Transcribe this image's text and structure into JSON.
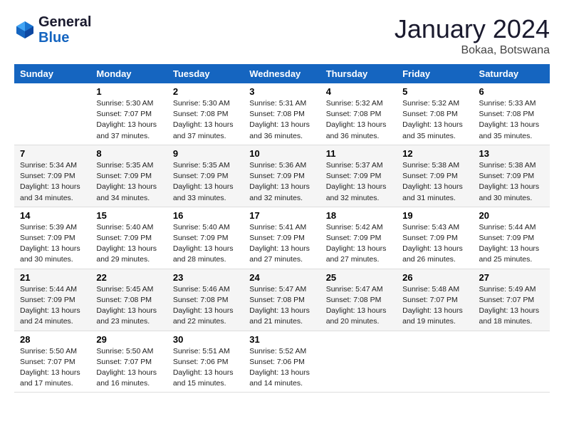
{
  "header": {
    "logo_general": "General",
    "logo_blue": "Blue",
    "month_year": "January 2024",
    "location": "Bokaa, Botswana"
  },
  "weekdays": [
    "Sunday",
    "Monday",
    "Tuesday",
    "Wednesday",
    "Thursday",
    "Friday",
    "Saturday"
  ],
  "weeks": [
    [
      {
        "day": "",
        "sunrise": "",
        "sunset": "",
        "daylight": ""
      },
      {
        "day": "1",
        "sunrise": "Sunrise: 5:30 AM",
        "sunset": "Sunset: 7:07 PM",
        "daylight": "Daylight: 13 hours and 37 minutes."
      },
      {
        "day": "2",
        "sunrise": "Sunrise: 5:30 AM",
        "sunset": "Sunset: 7:08 PM",
        "daylight": "Daylight: 13 hours and 37 minutes."
      },
      {
        "day": "3",
        "sunrise": "Sunrise: 5:31 AM",
        "sunset": "Sunset: 7:08 PM",
        "daylight": "Daylight: 13 hours and 36 minutes."
      },
      {
        "day": "4",
        "sunrise": "Sunrise: 5:32 AM",
        "sunset": "Sunset: 7:08 PM",
        "daylight": "Daylight: 13 hours and 36 minutes."
      },
      {
        "day": "5",
        "sunrise": "Sunrise: 5:32 AM",
        "sunset": "Sunset: 7:08 PM",
        "daylight": "Daylight: 13 hours and 35 minutes."
      },
      {
        "day": "6",
        "sunrise": "Sunrise: 5:33 AM",
        "sunset": "Sunset: 7:08 PM",
        "daylight": "Daylight: 13 hours and 35 minutes."
      }
    ],
    [
      {
        "day": "7",
        "sunrise": "Sunrise: 5:34 AM",
        "sunset": "Sunset: 7:09 PM",
        "daylight": "Daylight: 13 hours and 34 minutes."
      },
      {
        "day": "8",
        "sunrise": "Sunrise: 5:35 AM",
        "sunset": "Sunset: 7:09 PM",
        "daylight": "Daylight: 13 hours and 34 minutes."
      },
      {
        "day": "9",
        "sunrise": "Sunrise: 5:35 AM",
        "sunset": "Sunset: 7:09 PM",
        "daylight": "Daylight: 13 hours and 33 minutes."
      },
      {
        "day": "10",
        "sunrise": "Sunrise: 5:36 AM",
        "sunset": "Sunset: 7:09 PM",
        "daylight": "Daylight: 13 hours and 32 minutes."
      },
      {
        "day": "11",
        "sunrise": "Sunrise: 5:37 AM",
        "sunset": "Sunset: 7:09 PM",
        "daylight": "Daylight: 13 hours and 32 minutes."
      },
      {
        "day": "12",
        "sunrise": "Sunrise: 5:38 AM",
        "sunset": "Sunset: 7:09 PM",
        "daylight": "Daylight: 13 hours and 31 minutes."
      },
      {
        "day": "13",
        "sunrise": "Sunrise: 5:38 AM",
        "sunset": "Sunset: 7:09 PM",
        "daylight": "Daylight: 13 hours and 30 minutes."
      }
    ],
    [
      {
        "day": "14",
        "sunrise": "Sunrise: 5:39 AM",
        "sunset": "Sunset: 7:09 PM",
        "daylight": "Daylight: 13 hours and 30 minutes."
      },
      {
        "day": "15",
        "sunrise": "Sunrise: 5:40 AM",
        "sunset": "Sunset: 7:09 PM",
        "daylight": "Daylight: 13 hours and 29 minutes."
      },
      {
        "day": "16",
        "sunrise": "Sunrise: 5:40 AM",
        "sunset": "Sunset: 7:09 PM",
        "daylight": "Daylight: 13 hours and 28 minutes."
      },
      {
        "day": "17",
        "sunrise": "Sunrise: 5:41 AM",
        "sunset": "Sunset: 7:09 PM",
        "daylight": "Daylight: 13 hours and 27 minutes."
      },
      {
        "day": "18",
        "sunrise": "Sunrise: 5:42 AM",
        "sunset": "Sunset: 7:09 PM",
        "daylight": "Daylight: 13 hours and 27 minutes."
      },
      {
        "day": "19",
        "sunrise": "Sunrise: 5:43 AM",
        "sunset": "Sunset: 7:09 PM",
        "daylight": "Daylight: 13 hours and 26 minutes."
      },
      {
        "day": "20",
        "sunrise": "Sunrise: 5:44 AM",
        "sunset": "Sunset: 7:09 PM",
        "daylight": "Daylight: 13 hours and 25 minutes."
      }
    ],
    [
      {
        "day": "21",
        "sunrise": "Sunrise: 5:44 AM",
        "sunset": "Sunset: 7:09 PM",
        "daylight": "Daylight: 13 hours and 24 minutes."
      },
      {
        "day": "22",
        "sunrise": "Sunrise: 5:45 AM",
        "sunset": "Sunset: 7:08 PM",
        "daylight": "Daylight: 13 hours and 23 minutes."
      },
      {
        "day": "23",
        "sunrise": "Sunrise: 5:46 AM",
        "sunset": "Sunset: 7:08 PM",
        "daylight": "Daylight: 13 hours and 22 minutes."
      },
      {
        "day": "24",
        "sunrise": "Sunrise: 5:47 AM",
        "sunset": "Sunset: 7:08 PM",
        "daylight": "Daylight: 13 hours and 21 minutes."
      },
      {
        "day": "25",
        "sunrise": "Sunrise: 5:47 AM",
        "sunset": "Sunset: 7:08 PM",
        "daylight": "Daylight: 13 hours and 20 minutes."
      },
      {
        "day": "26",
        "sunrise": "Sunrise: 5:48 AM",
        "sunset": "Sunset: 7:07 PM",
        "daylight": "Daylight: 13 hours and 19 minutes."
      },
      {
        "day": "27",
        "sunrise": "Sunrise: 5:49 AM",
        "sunset": "Sunset: 7:07 PM",
        "daylight": "Daylight: 13 hours and 18 minutes."
      }
    ],
    [
      {
        "day": "28",
        "sunrise": "Sunrise: 5:50 AM",
        "sunset": "Sunset: 7:07 PM",
        "daylight": "Daylight: 13 hours and 17 minutes."
      },
      {
        "day": "29",
        "sunrise": "Sunrise: 5:50 AM",
        "sunset": "Sunset: 7:07 PM",
        "daylight": "Daylight: 13 hours and 16 minutes."
      },
      {
        "day": "30",
        "sunrise": "Sunrise: 5:51 AM",
        "sunset": "Sunset: 7:06 PM",
        "daylight": "Daylight: 13 hours and 15 minutes."
      },
      {
        "day": "31",
        "sunrise": "Sunrise: 5:52 AM",
        "sunset": "Sunset: 7:06 PM",
        "daylight": "Daylight: 13 hours and 14 minutes."
      },
      {
        "day": "",
        "sunrise": "",
        "sunset": "",
        "daylight": ""
      },
      {
        "day": "",
        "sunrise": "",
        "sunset": "",
        "daylight": ""
      },
      {
        "day": "",
        "sunrise": "",
        "sunset": "",
        "daylight": ""
      }
    ]
  ]
}
